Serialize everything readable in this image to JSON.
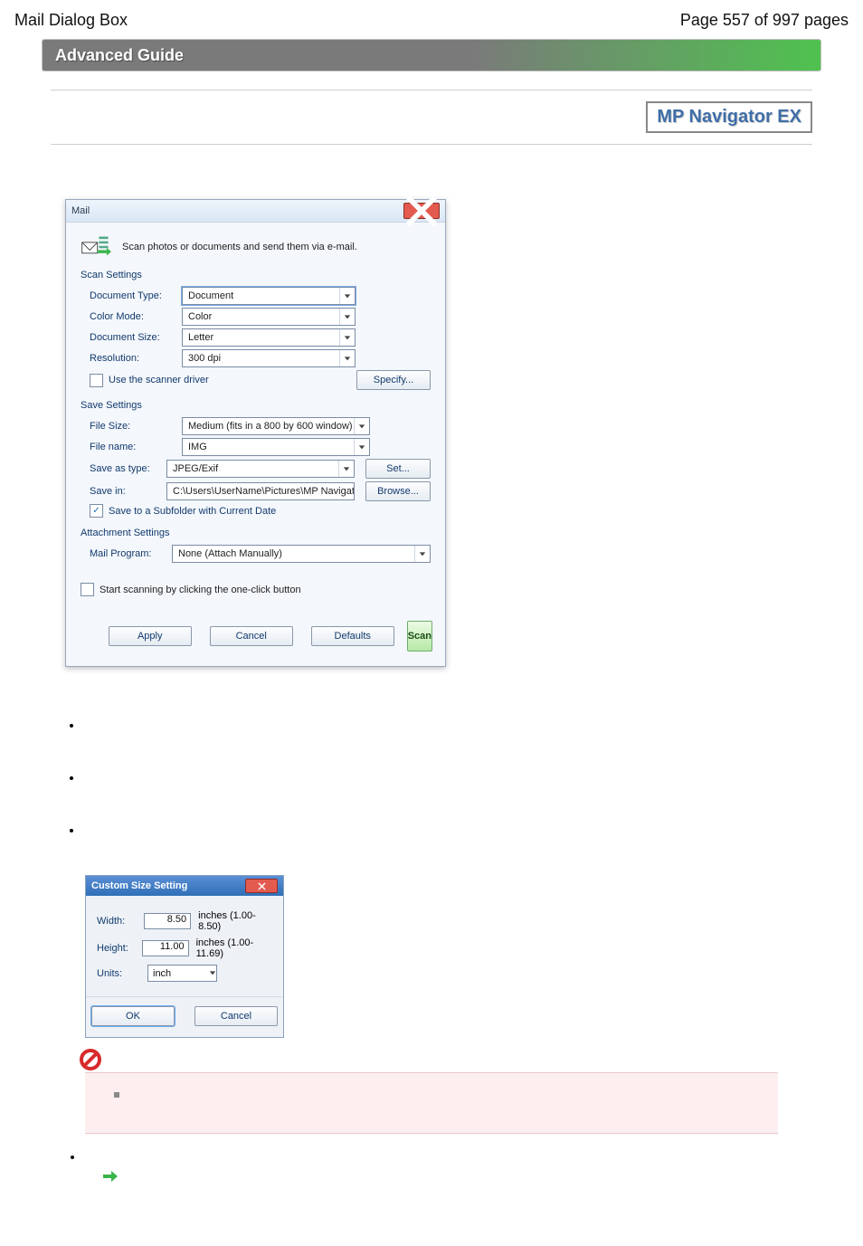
{
  "header": {
    "title": "Mail Dialog Box",
    "page_of": "Page 557 of 997 pages"
  },
  "advanced_bar": "Advanced Guide",
  "badge": "MP Navigator EX",
  "mail_dialog": {
    "title": "Mail",
    "subtitle": "Scan photos or documents and send them via e-mail.",
    "scan_settings": {
      "title": "Scan Settings",
      "document_type": {
        "label": "Document Type:",
        "value": "Document"
      },
      "color_mode": {
        "label": "Color Mode:",
        "value": "Color"
      },
      "document_size": {
        "label": "Document Size:",
        "value": "Letter"
      },
      "resolution": {
        "label": "Resolution:",
        "value": "300 dpi"
      },
      "use_scanner_driver": "Use the scanner driver",
      "specify_btn": "Specify..."
    },
    "save_settings": {
      "title": "Save Settings",
      "file_size": {
        "label": "File Size:",
        "value": "Medium (fits in a 800 by 600 window)"
      },
      "file_name": {
        "label": "File name:",
        "value": "IMG"
      },
      "save_as_type": {
        "label": "Save as type:",
        "value": "JPEG/Exif",
        "set_btn": "Set..."
      },
      "save_in": {
        "label": "Save in:",
        "value": "C:\\Users\\UserName\\Pictures\\MP Navigato",
        "browse_btn": "Browse..."
      },
      "subfolder_chk": "Save to a Subfolder with Current Date"
    },
    "attachment_settings": {
      "title": "Attachment Settings",
      "mail_program": {
        "label": "Mail Program:",
        "value": "None (Attach Manually)"
      }
    },
    "start_chk": "Start scanning by clicking the one-click button",
    "buttons": {
      "apply": "Apply",
      "cancel": "Cancel",
      "defaults": "Defaults",
      "scan": "Scan"
    }
  },
  "custom_size": {
    "title": "Custom Size Setting",
    "width": {
      "label": "Width:",
      "value": "8.50",
      "unit": "inches (1.00-8.50)"
    },
    "height": {
      "label": "Height:",
      "value": "11.00",
      "unit": "inches (1.00-11.69)"
    },
    "units": {
      "label": "Units:",
      "value": "inch"
    },
    "ok": "OK",
    "cancel": "Cancel"
  }
}
